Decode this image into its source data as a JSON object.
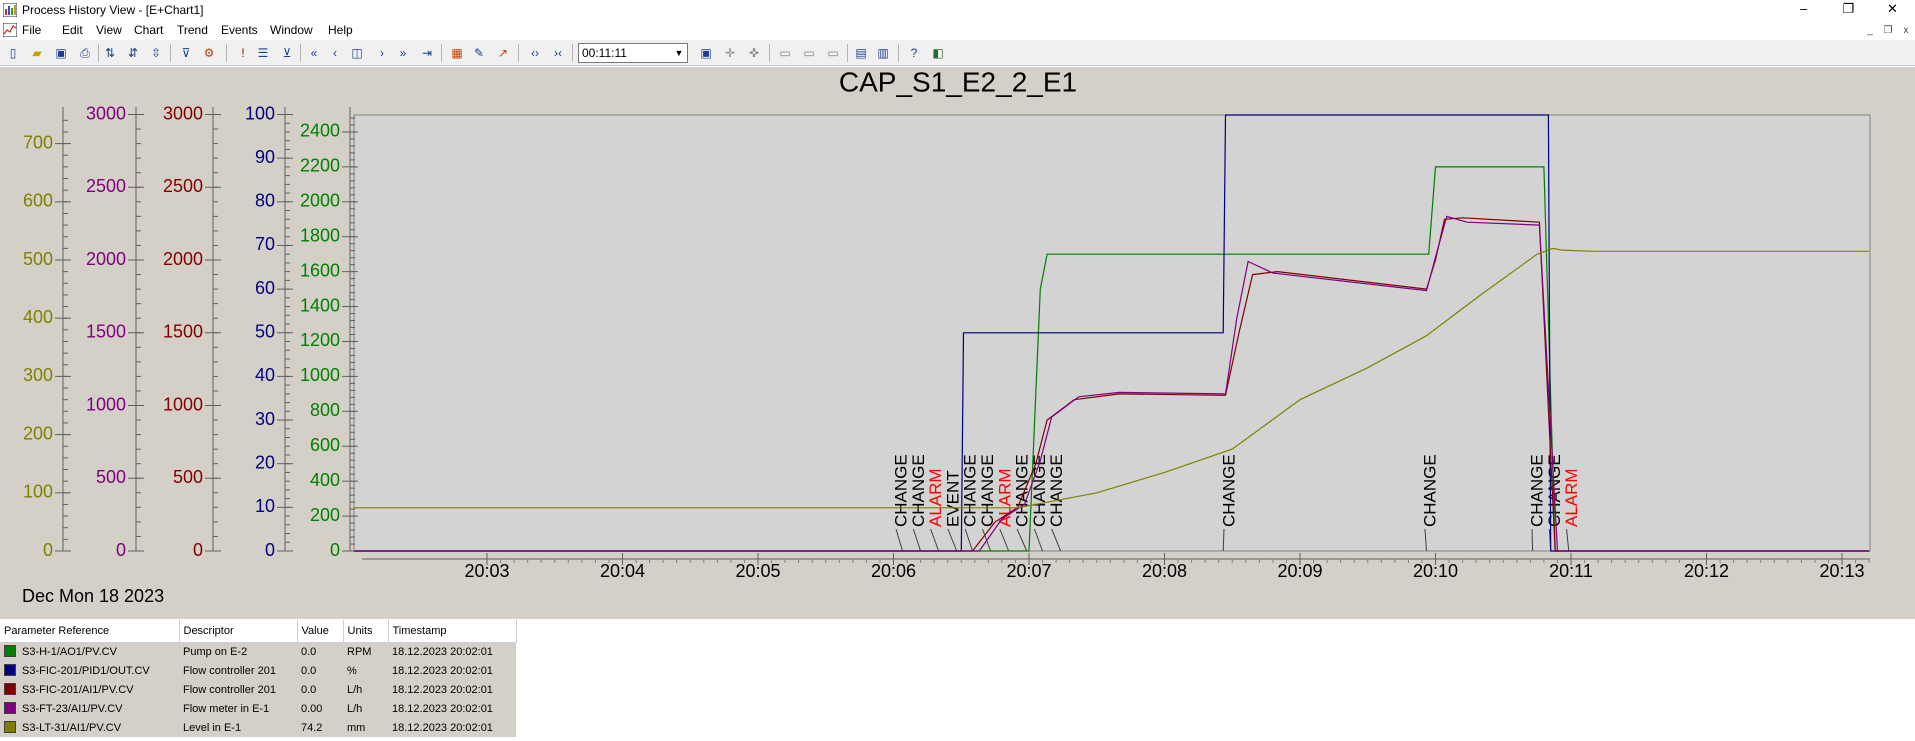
{
  "window": {
    "title": "Process History View - [E+Chart1]",
    "controls": {
      "minimize": "–",
      "restore": "❐",
      "close": "✕"
    }
  },
  "menu": [
    "File",
    "Edit",
    "View",
    "Chart",
    "Trend",
    "Events",
    "Window",
    "Help"
  ],
  "mdi_controls": {
    "minimize": "_",
    "restore": "❐",
    "close": "x"
  },
  "toolbar": {
    "time_span": "00:11:11",
    "icons": [
      "new-icon",
      "open-icon",
      "save-icon",
      "print-icon",
      "sort-asc-icon",
      "sort-desc-icon",
      "sort-icon",
      "filter-icon",
      "chart-settings-icon",
      "exclamation-icon",
      "event-list-icon",
      "filter-settings-icon",
      "first-icon",
      "prev-icon",
      "home-icon",
      "next-icon",
      "next-fast-icon",
      "last-icon",
      "chart-add-icon",
      "pen-icon",
      "trend-icon",
      "zoom-in-icon",
      "zoom-out-icon",
      "camera-icon",
      "cursor-icon",
      "cursor2-icon",
      "layout1-icon",
      "layout2-icon",
      "layout3-icon",
      "split-icon",
      "split2-icon",
      "help-icon",
      "info-icon"
    ]
  },
  "chart_data": {
    "type": "line",
    "title": "CAP_S1_E2_2_E1",
    "date_label": "Dec Mon 18 2023",
    "x_ticks": [
      "20:03",
      "20:04",
      "20:05",
      "20:06",
      "20:07",
      "20:08",
      "20:09",
      "20:10",
      "20:11",
      "20:12",
      "20:13"
    ],
    "xlim": [
      "20:02:01",
      "20:13:12"
    ],
    "axes": [
      {
        "id": "level",
        "color": "#808000",
        "ylim": [
          0,
          750
        ],
        "ticks": [
          0,
          100,
          200,
          300,
          400,
          500,
          600,
          700
        ]
      },
      {
        "id": "flow_meter",
        "color": "#800080",
        "ylim": [
          0,
          3000
        ],
        "ticks": [
          0,
          500,
          1000,
          1500,
          2000,
          2500,
          3000
        ]
      },
      {
        "id": "flow_ctrl",
        "color": "#800000",
        "ylim": [
          0,
          3000
        ],
        "ticks": [
          0,
          500,
          1000,
          1500,
          2000,
          2500,
          3000
        ]
      },
      {
        "id": "percent",
        "color": "#000080",
        "ylim": [
          0,
          100
        ],
        "ticks": [
          0,
          10,
          20,
          30,
          40,
          50,
          60,
          70,
          80,
          90,
          100
        ]
      },
      {
        "id": "rpm",
        "color": "#008000",
        "ylim": [
          0,
          2500
        ],
        "ticks": [
          0,
          200,
          400,
          600,
          800,
          1000,
          1200,
          1400,
          1600,
          1800,
          2000,
          2200,
          2400
        ]
      }
    ],
    "series": [
      {
        "name": "S3-H-1/AO1/PV.CV",
        "color": "#008000",
        "axis": "rpm",
        "points": [
          [
            "20:02:01",
            0
          ],
          [
            "20:07:00",
            0
          ],
          [
            "20:07:05",
            1500
          ],
          [
            "20:07:08",
            1700
          ],
          [
            "20:09:57",
            1700
          ],
          [
            "20:10:00",
            2200
          ],
          [
            "20:10:48",
            2200
          ],
          [
            "20:10:53",
            0
          ],
          [
            "20:13:12",
            0
          ]
        ]
      },
      {
        "name": "S3-FIC-201/PID1/OUT.CV",
        "color": "#000080",
        "axis": "percent",
        "points": [
          [
            "20:02:01",
            0
          ],
          [
            "20:06:30",
            0
          ],
          [
            "20:06:31",
            50
          ],
          [
            "20:08:26",
            50
          ],
          [
            "20:08:27",
            100
          ],
          [
            "20:10:50",
            100
          ],
          [
            "20:10:51",
            0
          ],
          [
            "20:13:12",
            0
          ]
        ]
      },
      {
        "name": "S3-FIC-201/AI1/PV.CV",
        "color": "#800000",
        "axis": "flow_ctrl",
        "points": [
          [
            "20:02:01",
            0
          ],
          [
            "20:06:35",
            0
          ],
          [
            "20:06:45",
            200
          ],
          [
            "20:06:55",
            300
          ],
          [
            "20:07:03",
            600
          ],
          [
            "20:07:08",
            900
          ],
          [
            "20:07:20",
            1040
          ],
          [
            "20:07:40",
            1080
          ],
          [
            "20:08:27",
            1070
          ],
          [
            "20:08:33",
            1500
          ],
          [
            "20:08:39",
            1900
          ],
          [
            "20:08:50",
            1920
          ],
          [
            "20:09:56",
            1800
          ],
          [
            "20:10:00",
            2000
          ],
          [
            "20:10:04",
            2280
          ],
          [
            "20:10:12",
            2290
          ],
          [
            "20:10:46",
            2260
          ],
          [
            "20:10:53",
            0
          ],
          [
            "20:13:12",
            0
          ]
        ]
      },
      {
        "name": "S3-FT-23/AI1/PV.CV",
        "color": "#800080",
        "axis": "flow_meter",
        "points": [
          [
            "20:02:01",
            0
          ],
          [
            "20:06:38",
            0
          ],
          [
            "20:06:48",
            220
          ],
          [
            "20:06:58",
            320
          ],
          [
            "20:07:05",
            620
          ],
          [
            "20:07:10",
            920
          ],
          [
            "20:07:22",
            1060
          ],
          [
            "20:07:40",
            1090
          ],
          [
            "20:08:27",
            1080
          ],
          [
            "20:08:32",
            1600
          ],
          [
            "20:08:37",
            1990
          ],
          [
            "20:08:48",
            1910
          ],
          [
            "20:09:56",
            1790
          ],
          [
            "20:10:00",
            2020
          ],
          [
            "20:10:05",
            2300
          ],
          [
            "20:10:14",
            2260
          ],
          [
            "20:10:46",
            2240
          ],
          [
            "20:10:54",
            0
          ],
          [
            "20:13:12",
            0
          ]
        ]
      },
      {
        "name": "S3-LT-31/AI1/PV.CV",
        "color": "#808000",
        "axis": "level",
        "points": [
          [
            "20:02:01",
            74.2
          ],
          [
            "20:06:55",
            74.2
          ],
          [
            "20:07:30",
            100
          ],
          [
            "20:08:00",
            135
          ],
          [
            "20:08:30",
            175
          ],
          [
            "20:09:00",
            260
          ],
          [
            "20:09:30",
            315
          ],
          [
            "20:09:56",
            370
          ],
          [
            "20:10:20",
            440
          ],
          [
            "20:10:45",
            510
          ],
          [
            "20:10:52",
            520
          ],
          [
            "20:10:56",
            517
          ],
          [
            "20:11:10",
            515
          ],
          [
            "20:13:12",
            515
          ]
        ]
      }
    ],
    "events": [
      {
        "time": "20:06:04",
        "label": "CHANGE",
        "color": "#000000"
      },
      {
        "time": "20:06:12",
        "label": "CHANGE",
        "color": "#000000"
      },
      {
        "time": "20:06:20",
        "label": "ALARM",
        "color": "#ff0000"
      },
      {
        "time": "20:06:28",
        "label": "EVENT",
        "color": "#000000"
      },
      {
        "time": "20:06:35",
        "label": "CHANGE",
        "color": "#000000"
      },
      {
        "time": "20:06:43",
        "label": "CHANGE",
        "color": "#000000"
      },
      {
        "time": "20:06:51",
        "label": "ALARM",
        "color": "#ff0000"
      },
      {
        "time": "20:06:59",
        "label": "CHANGE",
        "color": "#000000"
      },
      {
        "time": "20:07:06",
        "label": "CHANGE",
        "color": "#000000"
      },
      {
        "time": "20:07:14",
        "label": "CHANGE",
        "color": "#000000"
      },
      {
        "time": "20:08:26",
        "label": "CHANGE",
        "color": "#000000"
      },
      {
        "time": "20:09:56",
        "label": "CHANGE",
        "color": "#000000"
      },
      {
        "time": "20:10:43",
        "label": "CHANGE",
        "color": "#000000"
      },
      {
        "time": "20:10:51",
        "label": "CHANGE",
        "color": "#000000"
      },
      {
        "time": "20:10:59",
        "label": "ALARM",
        "color": "#ff0000"
      }
    ]
  },
  "legend": {
    "headers": [
      "Parameter Reference",
      "Descriptor",
      "Value",
      "Units",
      "Timestamp"
    ],
    "rows": [
      {
        "color": "#008000",
        "ref": "S3-H-1/AO1/PV.CV",
        "desc": "Pump on E-2",
        "value": "0.0",
        "units": "RPM",
        "ts": "18.12.2023 20:02:01"
      },
      {
        "color": "#000080",
        "ref": "S3-FIC-201/PID1/OUT.CV",
        "desc": "Flow controller 201",
        "value": "0.0",
        "units": "%",
        "ts": "18.12.2023 20:02:01"
      },
      {
        "color": "#800000",
        "ref": "S3-FIC-201/AI1/PV.CV",
        "desc": "Flow controller 201",
        "value": "0.0",
        "units": "L/h",
        "ts": "18.12.2023 20:02:01"
      },
      {
        "color": "#800080",
        "ref": "S3-FT-23/AI1/PV.CV",
        "desc": "Flow meter in E-1",
        "value": "0.00",
        "units": "L/h",
        "ts": "18.12.2023 20:02:01"
      },
      {
        "color": "#808000",
        "ref": "S3-LT-31/AI1/PV.CV",
        "desc": "Level in E-1",
        "value": "74.2",
        "units": "mm",
        "ts": "18.12.2023 20:02:01"
      }
    ]
  }
}
